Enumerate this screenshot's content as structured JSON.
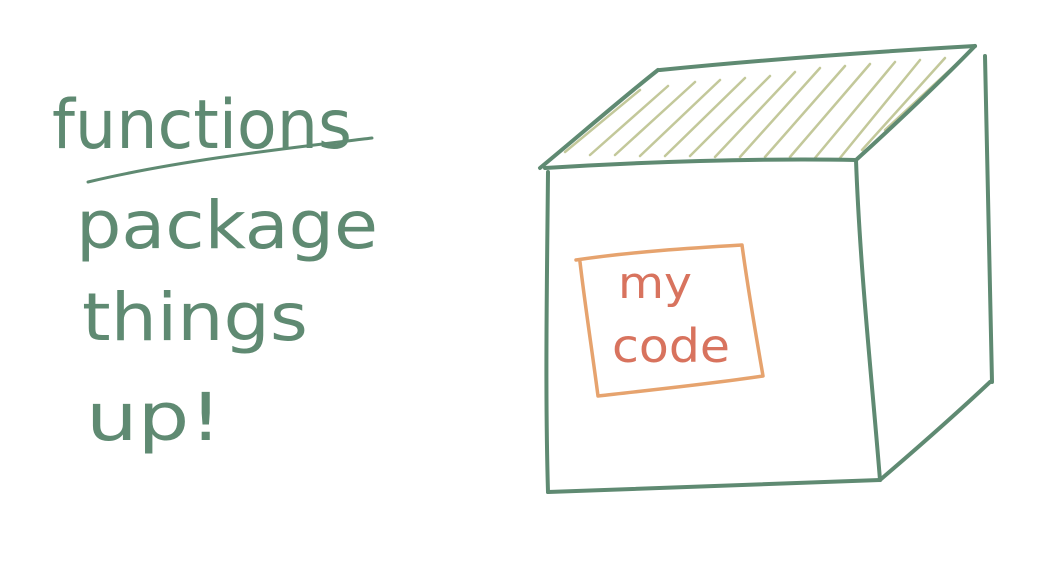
{
  "sketch": {
    "heading": "functions",
    "lines": [
      "package",
      "things",
      "up!"
    ],
    "label": [
      "my",
      "code"
    ]
  },
  "colors": {
    "ink": "#5f8a72",
    "hatch": "#c3c89a",
    "label_border": "#e6a36e",
    "label_text": "#d8735e",
    "background": "#ffffff"
  }
}
